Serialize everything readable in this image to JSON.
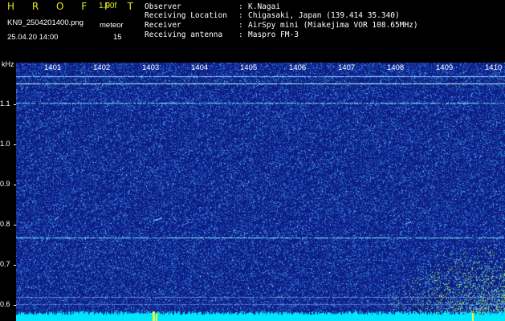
{
  "header": {
    "logo": "H R O F F T",
    "version": "1.00f",
    "filename": "KN9_2504201400.png",
    "meteor_label": "meteor",
    "datetime": "25.04.20 14:00",
    "count": "15",
    "info": [
      {
        "label": "Observer",
        "value": "K.Nagai"
      },
      {
        "label": "Receiving Location",
        "value": "Chigasaki, Japan (139.414 35.340)"
      },
      {
        "label": "Receiver",
        "value": "AirSpy mini (Miakejima VOR 108.65MHz)"
      },
      {
        "label": "Receiving antenna",
        "value": "Maspro FM-3"
      }
    ]
  },
  "spectrogram": {
    "y_unit": "kHz",
    "y_ticks": [
      "1.1",
      "1.0",
      "0.9",
      "0.8",
      "0.7",
      "0.6"
    ],
    "x_ticks": [
      "1401",
      "1402",
      "1403",
      "1404",
      "1405",
      "1406",
      "1407",
      "1408",
      "1409",
      "1410"
    ],
    "colors": {
      "background": "#0d1e85",
      "noise": "#1f6ad0",
      "signal": "#5fe6ff",
      "strong": "#e6ff40",
      "baseline": "#00e6ff"
    }
  }
}
